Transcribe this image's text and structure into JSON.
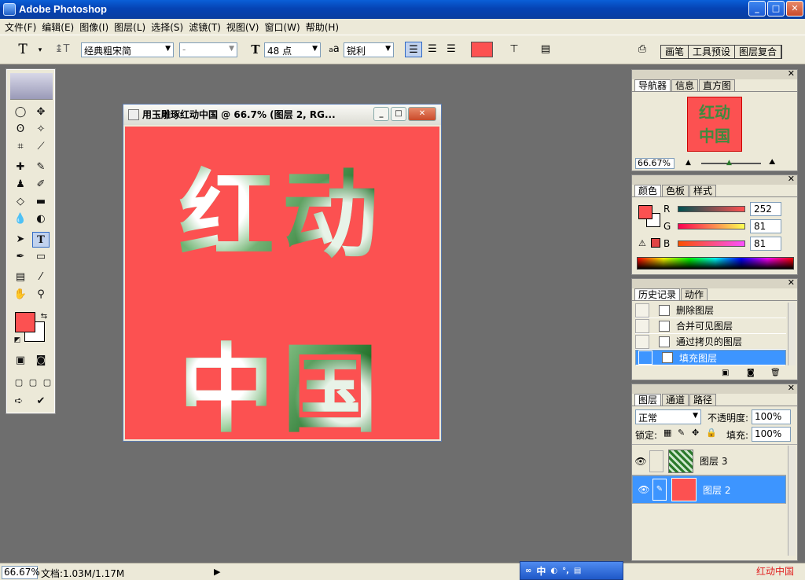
{
  "app": {
    "title": "Adobe Photoshop"
  },
  "menu": [
    "文件(F)",
    "编辑(E)",
    "图像(I)",
    "图层(L)",
    "选择(S)",
    "滤镜(T)",
    "视图(V)",
    "窗口(W)",
    "帮助(H)"
  ],
  "options": {
    "font_family": "经典粗宋简",
    "font_style": "-",
    "font_size": "48 点",
    "aa_label": "a",
    "antialias": "锐利",
    "text_color": "#fc5151"
  },
  "palette_well": [
    "画笔",
    "工具预设",
    "图层复合"
  ],
  "document": {
    "title": "用玉雕琢红动中国 @ 66.7% (图层 2, RG...",
    "canvas_color": "#fc5151",
    "line1": "红动",
    "line2": "中国"
  },
  "navigator": {
    "tabs": [
      "导航器",
      "信息",
      "直方图"
    ],
    "zoom": "66.67%",
    "thumb_line1": "红动",
    "thumb_line2": "中国"
  },
  "color_panel": {
    "tabs": [
      "颜色",
      "色板",
      "样式"
    ],
    "r_label": "R",
    "g_label": "G",
    "b_label": "B",
    "r": "252",
    "g": "81",
    "b": "81",
    "foreground": "#fc5151"
  },
  "history": {
    "tabs": [
      "历史记录",
      "动作"
    ],
    "items": [
      "删除图层",
      "合并可见图层",
      "通过拷贝的图层",
      "填充图层"
    ]
  },
  "layers": {
    "tabs": [
      "图层",
      "通道",
      "路径"
    ],
    "blend_mode": "正常",
    "opacity_label": "不透明度:",
    "opacity": "100%",
    "lock_label": "锁定:",
    "fill_label": "填充:",
    "fill": "100%",
    "rows": [
      "图层 3",
      "图层 2"
    ]
  },
  "status": {
    "zoom": "66.67%",
    "doc_info": "文档:1.03M/1.17M"
  },
  "tray": {
    "ime": "中"
  },
  "watermark": "红动中国"
}
